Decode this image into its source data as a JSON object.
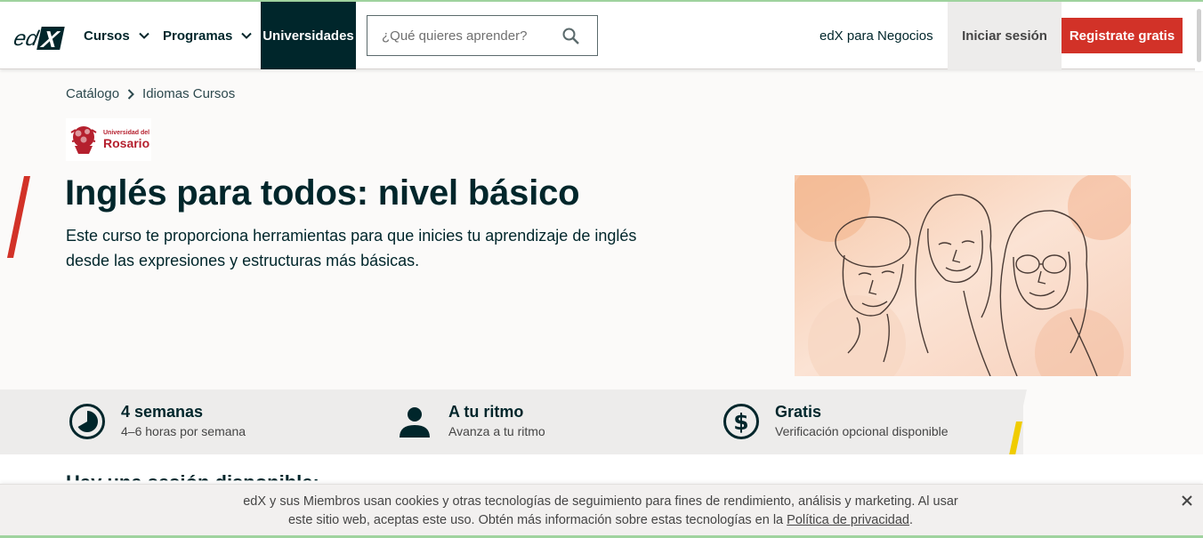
{
  "header": {
    "logo_text": "edX",
    "nav": {
      "cursos": "Cursos",
      "programas": "Programas",
      "universidades": "Universidades"
    },
    "search_placeholder": "¿Qué quieres aprender?",
    "business_link": "edX para Negocios",
    "login": "Iniciar sesión",
    "register": "Registrate gratis"
  },
  "breadcrumb": {
    "items": [
      "Catálogo",
      "Idiomas Cursos"
    ]
  },
  "org": {
    "name_small": "Universidad del",
    "name_big": "Rosario"
  },
  "course": {
    "title": "Inglés para todos: nivel básico",
    "description": "Este curso te proporciona herramientas para que inicies tu aprendizaje de inglés desde las expresiones y estructuras más básicas."
  },
  "stats": [
    {
      "title": "4 semanas",
      "subtitle": "4–6 horas por semana",
      "icon": "clock-icon"
    },
    {
      "title": "A tu ritmo",
      "subtitle": "Avanza a tu ritmo",
      "icon": "person-icon"
    },
    {
      "title": "Gratis",
      "subtitle": "Verificación opcional disponible",
      "icon": "dollar-icon"
    }
  ],
  "lower": {
    "heading": "Hay una sesión disponible:"
  },
  "cookie": {
    "text_before": "edX y sus Miembros usan cookies y otras tecnologías de seguimiento para fines de rendimiento, análisis y marketing. Al usar este sitio web, aceptas este uso. Obtén más información sobre estas tecnologías en la ",
    "link": "Política de privacidad",
    "text_after": "."
  },
  "colors": {
    "brand_dark": "#00262b",
    "accent_red": "#d23228",
    "accent_yellow": "#f0cc00"
  }
}
